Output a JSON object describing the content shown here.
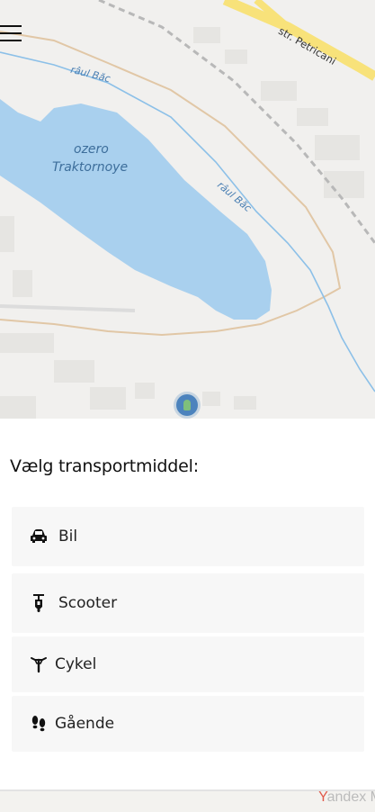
{
  "map": {
    "lake_label_line1": "ozero",
    "lake_label_line2": "Traktornoye",
    "river_label_1": "râul Băc",
    "river_label_2": "râul Băc",
    "street_label": "str. Petricani",
    "attribution_prefix": "Y",
    "attribution_rest": "andex M"
  },
  "panel": {
    "title": "Vælg transportmiddel:",
    "options": [
      {
        "label": "Bil",
        "icon": "car-icon"
      },
      {
        "label": "Scooter",
        "icon": "scooter-icon"
      },
      {
        "label": "Cykel",
        "icon": "bicycle-icon"
      },
      {
        "label": "Gående",
        "icon": "footprints-icon"
      }
    ]
  },
  "colors": {
    "water": "#a9d0ee",
    "map_bg": "#f1f0ee",
    "panel_option_bg": "#f7f7f7",
    "street_yellow": "#f8e27a"
  }
}
